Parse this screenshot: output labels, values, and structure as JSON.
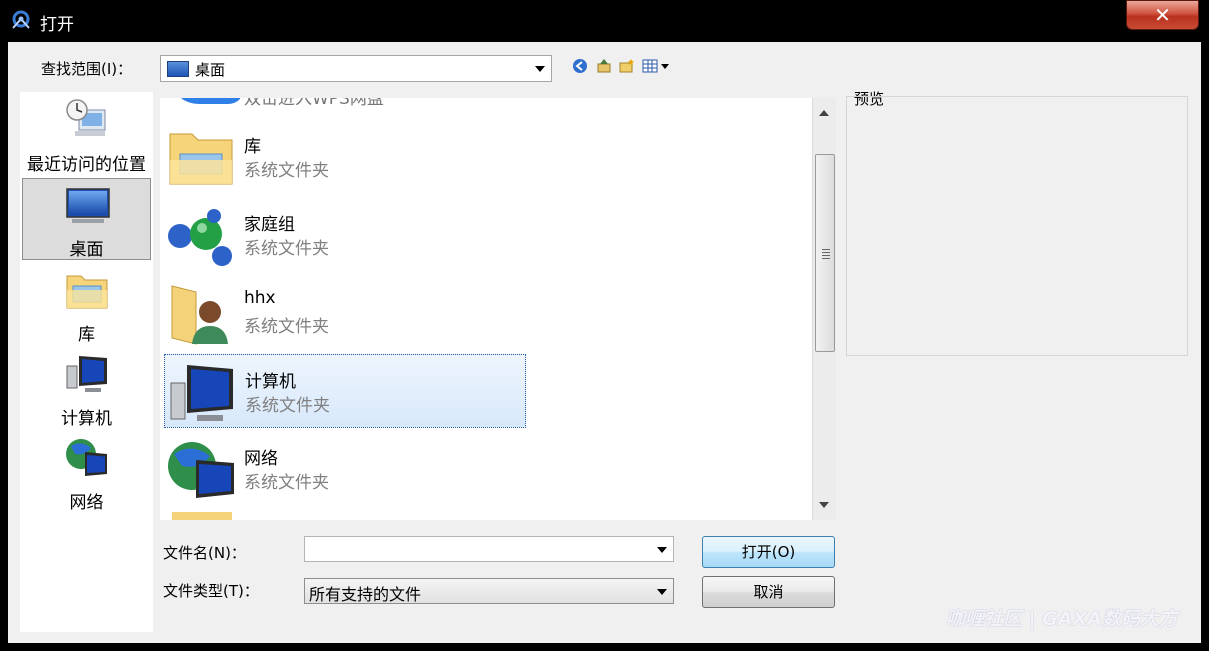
{
  "window": {
    "title": "打开",
    "close_label": "✕"
  },
  "lookin": {
    "label": "查找范围(I)：",
    "value": "桌面"
  },
  "places": [
    {
      "label": "最近访问的位置"
    },
    {
      "label": "桌面",
      "selected": true
    },
    {
      "label": "库"
    },
    {
      "label": "计算机"
    },
    {
      "label": "网络"
    }
  ],
  "files": {
    "partial_top_label": "双击进入WPS网盘",
    "items": [
      {
        "name": "库",
        "type": "系统文件夹"
      },
      {
        "name": "家庭组",
        "type": "系统文件夹"
      },
      {
        "name": "hhx",
        "type": "系统文件夹"
      },
      {
        "name": "计算机",
        "type": "系统文件夹",
        "selected": true
      },
      {
        "name": "网络",
        "type": "系统文件夹"
      }
    ]
  },
  "preview": {
    "label": "预览"
  },
  "filename": {
    "label": "文件名(N)：",
    "value": ""
  },
  "filetype": {
    "label": "文件类型(T)：",
    "value": "所有支持的文件"
  },
  "buttons": {
    "open": "打开(O)",
    "cancel": "取消"
  },
  "watermark": "咖喱社区 | GAXA数码大方"
}
